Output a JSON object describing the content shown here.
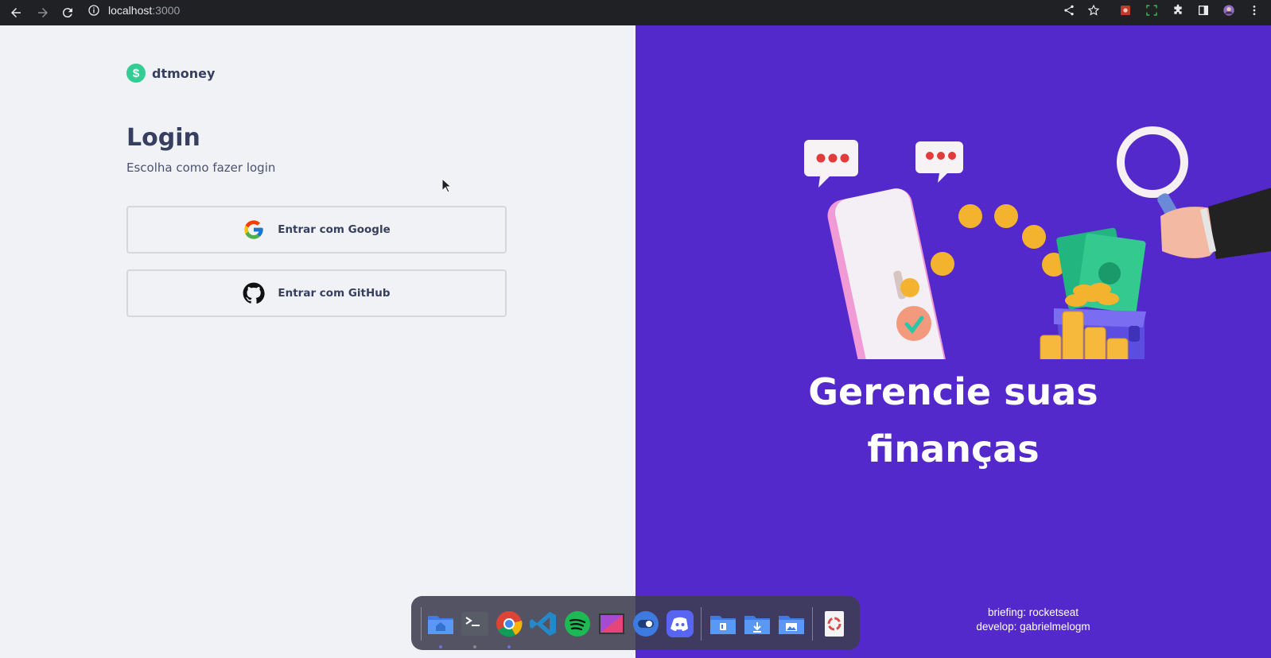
{
  "browser": {
    "url_host": "localhost",
    "url_port": ":3000"
  },
  "login": {
    "brand": "dtmoney",
    "brand_icon": "$",
    "title": "Login",
    "subtitle": "Escolha como fazer login",
    "google_label": "Entrar com Google",
    "github_label": "Entrar com GitHub"
  },
  "hero": {
    "headline_line1": "Gerencie suas",
    "headline_line2": "finanças",
    "credit_briefing": "briefing: rocketseat",
    "credit_develop": "develop: gabrielmelogm"
  },
  "colors": {
    "accent_green": "#33cc95",
    "accent_purple": "#5429cc",
    "text_dark": "#363f5f"
  },
  "dock": {
    "apps": [
      "home-folder",
      "terminal",
      "chrome",
      "vscode",
      "spotify",
      "screenshot",
      "toggle-app",
      "discord",
      "trello-folder",
      "downloads-folder",
      "pictures-folder",
      "trash"
    ]
  }
}
